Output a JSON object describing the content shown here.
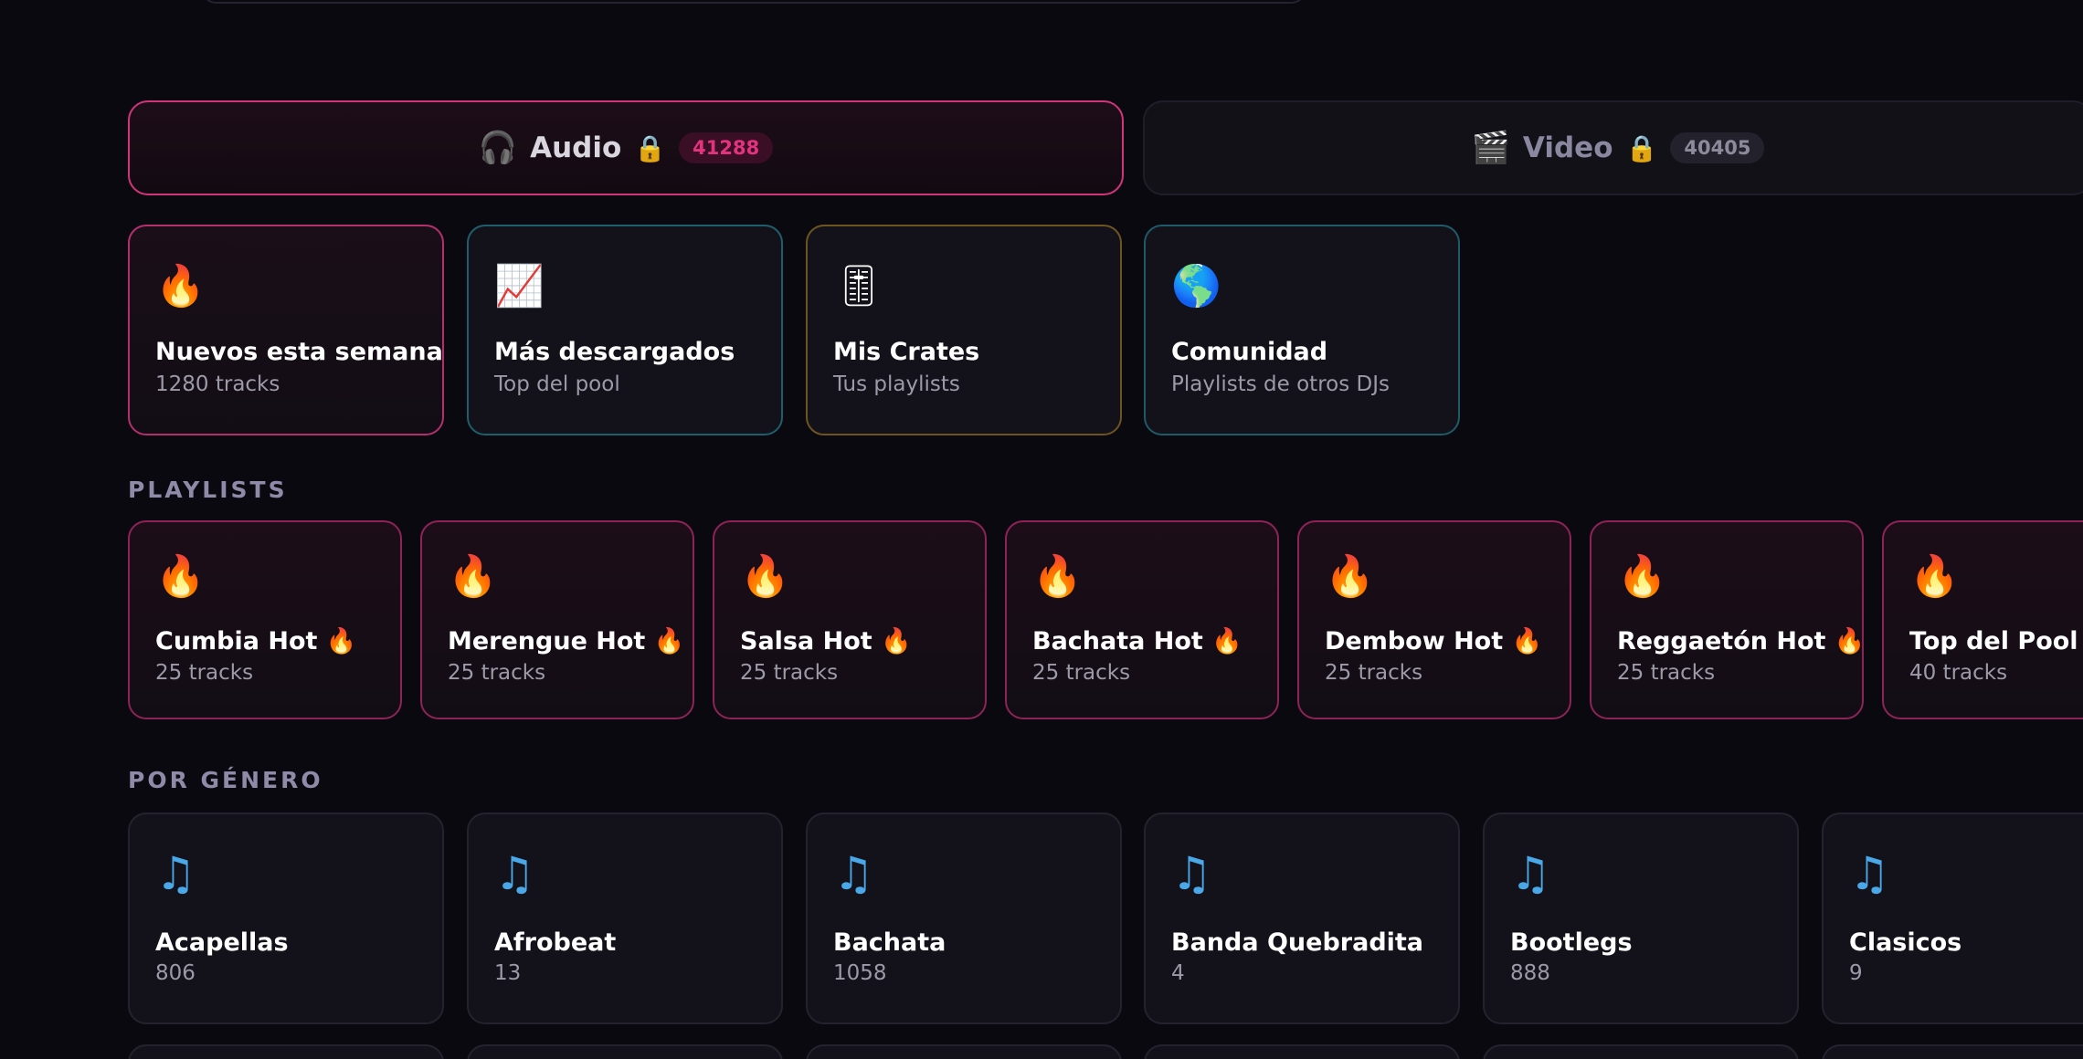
{
  "tabs": [
    {
      "icon": "🎧",
      "label": "Audio",
      "lock": "🔒",
      "count": "41288",
      "active": true
    },
    {
      "icon": "🎬",
      "label": "Video",
      "lock": "🔒",
      "count": "40405",
      "active": false
    }
  ],
  "quick_cards": [
    {
      "icon": "🔥",
      "title": "Nuevos esta semana",
      "subtitle": "1280 tracks"
    },
    {
      "icon": "📈",
      "title": "Más descargados",
      "subtitle": "Top del pool"
    },
    {
      "icon": "🎚",
      "title": "Mis Crates",
      "subtitle": "Tus playlists"
    },
    {
      "icon": "🌎",
      "title": "Comunidad",
      "subtitle": "Playlists de otros DJs"
    }
  ],
  "playlists_heading": "PLAYLISTS",
  "playlists": [
    {
      "icon": "🔥",
      "title": "Cumbia Hot 🔥",
      "subtitle": "25 tracks"
    },
    {
      "icon": "🔥",
      "title": "Merengue Hot 🔥",
      "subtitle": "25 tracks"
    },
    {
      "icon": "🔥",
      "title": "Salsa Hot 🔥",
      "subtitle": "25 tracks"
    },
    {
      "icon": "🔥",
      "title": "Bachata Hot 🔥",
      "subtitle": "25 tracks"
    },
    {
      "icon": "🔥",
      "title": "Dembow Hot 🔥",
      "subtitle": "25 tracks"
    },
    {
      "icon": "🔥",
      "title": "Reggaetón Hot 🔥",
      "subtitle": "25 tracks"
    },
    {
      "icon": "🔥",
      "title": "Top del Pool 📈",
      "subtitle": "40 tracks"
    }
  ],
  "genres_heading": "POR GÉNERO",
  "genres": [
    {
      "icon": "♫",
      "title": "Acapellas",
      "count": "806"
    },
    {
      "icon": "♫",
      "title": "Afrobeat",
      "count": "13"
    },
    {
      "icon": "♫",
      "title": "Bachata",
      "count": "1058"
    },
    {
      "icon": "♫",
      "title": "Banda Quebradita",
      "count": "4"
    },
    {
      "icon": "♫",
      "title": "Bootlegs",
      "count": "888"
    },
    {
      "icon": "♫",
      "title": "Clasicos",
      "count": "9"
    }
  ]
}
